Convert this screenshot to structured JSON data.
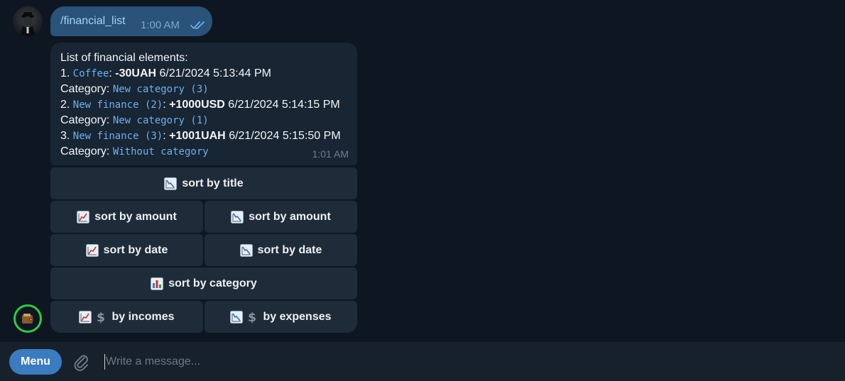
{
  "outgoing": {
    "text": "/financial_list",
    "time": "1:00 AM"
  },
  "incoming": {
    "header": "List of financial elements:",
    "items": [
      {
        "index": "1.",
        "title": "Coffee",
        "amount": "-30UAH",
        "date": "6/21/2024 5:13:44 PM",
        "category_label": "Category:",
        "category": "New category (3)"
      },
      {
        "index": "2.",
        "title": "New finance (2)",
        "amount": "+1000USD",
        "date": "6/21/2024 5:14:15 PM",
        "category_label": "Category:",
        "category": "New category (1)"
      },
      {
        "index": "3.",
        "title": "New finance (3)",
        "amount": "+1001UAH",
        "date": "6/21/2024 5:15:50 PM",
        "category_label": "Category:",
        "category": "Without category"
      }
    ],
    "time": "1:01 AM"
  },
  "keyboard": {
    "sort_title": "sort by title",
    "sort_amount_asc": "sort by amount",
    "sort_amount_desc": "sort by amount",
    "sort_date_asc": "sort by date",
    "sort_date_desc": "sort by date",
    "sort_category": "sort by category",
    "by_incomes": "by incomes",
    "by_expenses": "by expenses"
  },
  "composer": {
    "menu_label": "Menu",
    "placeholder": "Write a message..."
  },
  "icons": {
    "chart_increasing": "chart-increasing-icon",
    "chart_decreasing": "chart-decreasing-icon",
    "bar_chart": "bar-chart-icon",
    "dollar": "dollar-sign-icon",
    "attach": "paperclip-icon",
    "read_checks": "double-check-icon"
  },
  "colors": {
    "background": "#0e1621",
    "outgoing_bubble": "#2b5278",
    "incoming_bubble": "#182533",
    "button": "#1e2c3a",
    "link_mono": "#6ab2f2",
    "menu_button": "#3a7cbf",
    "bot_ring": "#2ecc40"
  }
}
